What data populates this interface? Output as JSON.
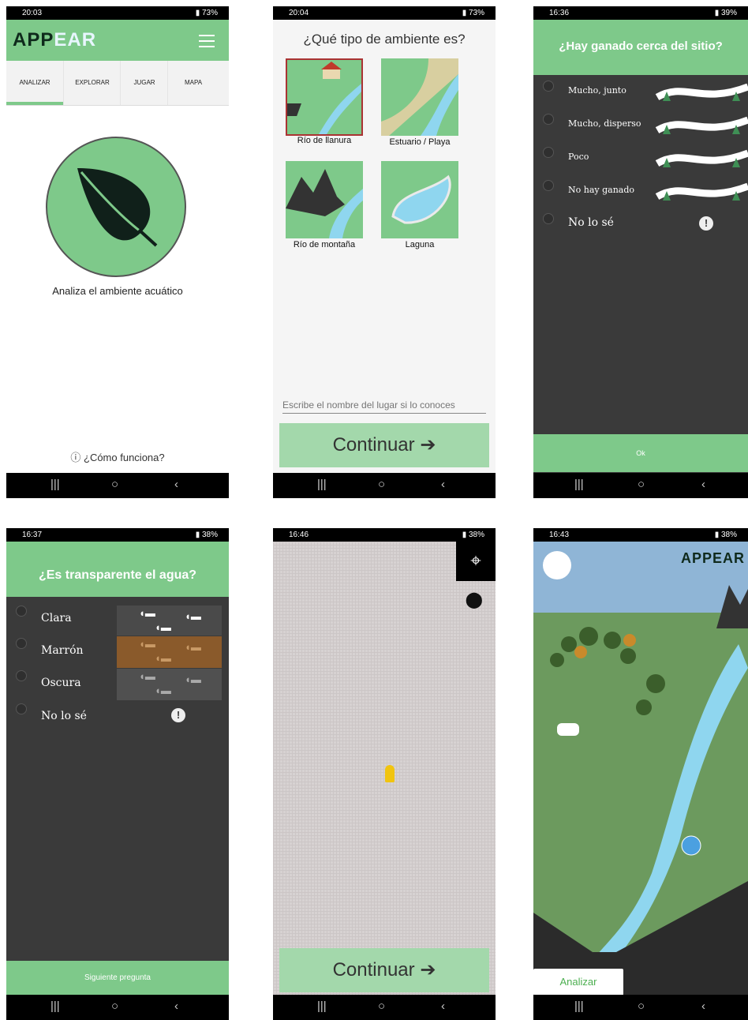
{
  "colors": {
    "green": "#7ec98a",
    "dark": "#3a3a3a",
    "black": "#000000"
  },
  "s1": {
    "time": "20:03",
    "battery": "73%",
    "logo": "APPEAR",
    "tabs": [
      "ANALIZAR",
      "EXPLORAR",
      "JUGAR",
      "MAPA"
    ],
    "main_text": "Analiza el ambiente acuático",
    "help": "¿Cómo funciona?",
    "icon": "leaf-icon"
  },
  "s2": {
    "time": "20:04",
    "battery": "73%",
    "title": "¿Qué tipo de ambiente es?",
    "options": [
      "Río de llanura",
      "Estuario / Playa",
      "Río de montaña",
      "Laguna"
    ],
    "placeholder": "Escribe el nombre del lugar si lo conoces",
    "continue": "Continuar"
  },
  "s3": {
    "time": "16:36",
    "battery": "39%",
    "title": "¿Hay ganado cerca del sitio?",
    "options": [
      "Mucho, junto",
      "Mucho, disperso",
      "Poco",
      "No hay ganado",
      "No lo sé"
    ],
    "ok": "Ok"
  },
  "s4": {
    "time": "16:37",
    "battery": "38%",
    "title": "¿Es transparente el agua?",
    "options": [
      "Clara",
      "Marrón",
      "Oscura",
      "No lo sé"
    ],
    "next": "Siguiente pregunta"
  },
  "s5": {
    "time": "16:46",
    "battery": "38%",
    "continue": "Continuar"
  },
  "s6": {
    "time": "16:43",
    "battery": "38%",
    "logo": "APPEAR",
    "button": "Analizar"
  }
}
